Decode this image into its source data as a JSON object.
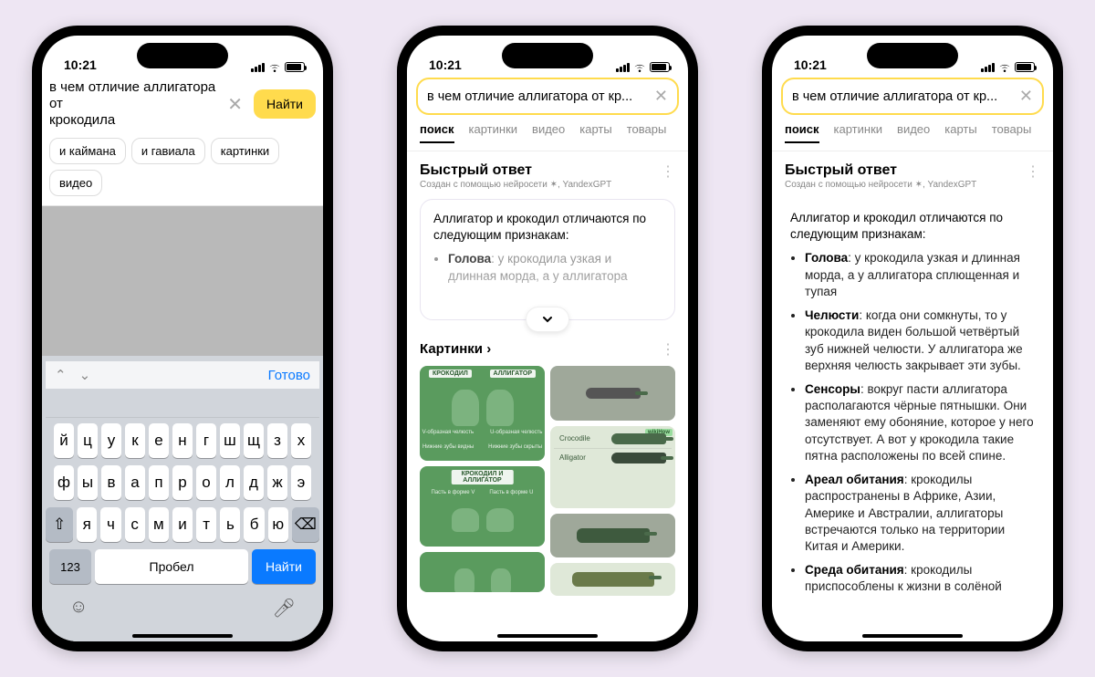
{
  "status": {
    "time": "10:21"
  },
  "phone1": {
    "query": "в чем отличие аллигатора от\nкрокодила",
    "find": "Найти",
    "chips": [
      "и каймана",
      "и гавиала",
      "картинки",
      "видео"
    ],
    "kb": {
      "done": "Готово",
      "row1": [
        "й",
        "ц",
        "у",
        "к",
        "е",
        "н",
        "г",
        "ш",
        "щ",
        "з",
        "х"
      ],
      "row2": [
        "ф",
        "ы",
        "в",
        "а",
        "п",
        "р",
        "о",
        "л",
        "д",
        "ж",
        "э"
      ],
      "row3": [
        "я",
        "ч",
        "с",
        "м",
        "и",
        "т",
        "ь",
        "б",
        "ю"
      ],
      "n123": "123",
      "space": "Пробел",
      "enter": "Найти"
    }
  },
  "phone2": {
    "query": "в чем отличие аллигатора от кр...",
    "tabs": [
      "поиск",
      "картинки",
      "видео",
      "карты",
      "товары"
    ],
    "qa_title": "Быстрый ответ",
    "qa_sub": "Создан с помощью нейросети ✶, YandexGPT",
    "qa_intro": "Аллигатор и крокодил отличаются по следующим признакам:",
    "qa_bullet1_b": "Голова",
    "qa_bullet1_t": ": у крокодила узкая и длинная морда, а у аллигатора",
    "imgs_title": "Картинки",
    "img_labels": {
      "croc": "КРОКОДИЛ",
      "alli": "АЛЛИГАТОР",
      "both": "КРОКОДИЛ И АЛЛИГАТОР"
    },
    "img_sub1": "V-образная челюсть",
    "img_sub2": "U-образная челюсть",
    "img_sub3": "Нижние зубы видны",
    "img_sub4": "Нижние зубы скрыты",
    "img_sub5": "Пасть в форме V",
    "img_sub6": "Пасть в форме U",
    "wiki": {
      "logo": "wikiHow",
      "r1": "Crocodile",
      "r2": "Alligator"
    }
  },
  "phone3": {
    "query": "в чем отличие аллигатора от кр...",
    "tabs": [
      "поиск",
      "картинки",
      "видео",
      "карты",
      "товары"
    ],
    "qa_title": "Быстрый ответ",
    "qa_sub": "Создан с помощью нейросети ✶, YandexGPT",
    "qa_intro": "Аллигатор и крокодил отличаются по следующим признакам:",
    "bullets": [
      {
        "b": "Голова",
        "t": ": у крокодила узкая и длинная морда, а у аллигатора сплющенная и тупая"
      },
      {
        "b": "Челюсти",
        "t": ": когда они сомкнуты, то у крокодила виден большой четвёртый зуб нижней челюсти. У аллигатора же верхняя челюсть закрывает эти зубы."
      },
      {
        "b": "Сенсоры",
        "t": ": вокруг пасти аллигатора располагаются чёрные пятнышки. Они заменяют ему обоняние, которое у него отсутствует. А вот у крокодила такие пятна расположены по всей спине."
      },
      {
        "b": "Ареал обитания",
        "t": ": крокодилы распространены в Африке, Азии, Америке и Австралии, аллигаторы встречаются только на территории Китая и Америки."
      },
      {
        "b": "Среда обитания",
        "t": ": крокодилы приспособлены к жизни в солёной"
      }
    ]
  }
}
